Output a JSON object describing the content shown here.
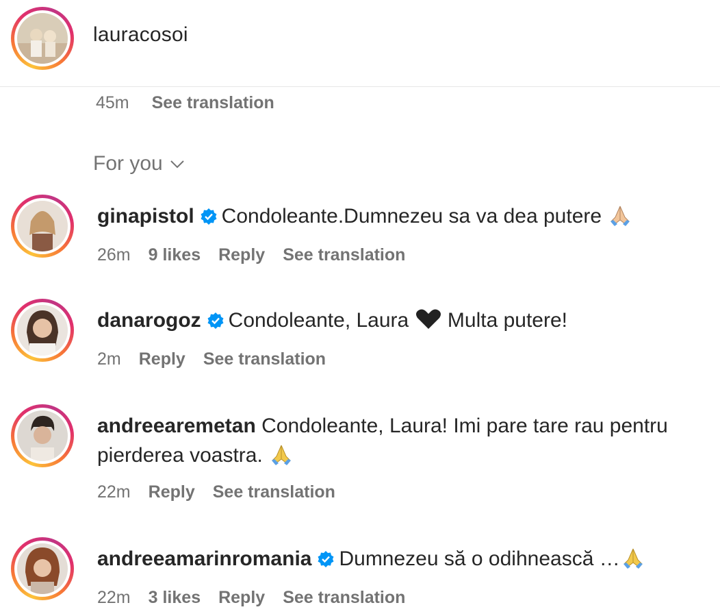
{
  "post": {
    "username": "lauracosoi",
    "time": "45m",
    "see_translation": "See translation"
  },
  "filter": {
    "label": "For you"
  },
  "comments": [
    {
      "username": "ginapistol",
      "verified": true,
      "text": "Condoleante.Dumnezeu sa va dea putere",
      "emoji": "praying-hands",
      "time": "26m",
      "likes": "9 likes",
      "reply": "Reply",
      "see_translation": "See translation"
    },
    {
      "username": "danarogoz",
      "verified": true,
      "text": "Condoleante, Laura",
      "emoji": "black-heart",
      "text2": "Multa putere!",
      "time": "2m",
      "reply": "Reply",
      "see_translation": "See translation"
    },
    {
      "username": "andreearemetan",
      "verified": false,
      "text": "Condoleante, Laura! Imi pare tare rau pentru pierderea voastra.",
      "emoji": "praying-hands",
      "time": "22m",
      "reply": "Reply",
      "see_translation": "See translation"
    },
    {
      "username": "andreeamarinromania",
      "verified": true,
      "text": "Dumnezeu să o odihnească …",
      "emoji": "praying-hands",
      "time": "22m",
      "likes": "3 likes",
      "reply": "Reply",
      "see_translation": "See translation"
    }
  ],
  "colors": {
    "verified": "#0095f6",
    "meta": "#737373",
    "text": "#262626"
  }
}
